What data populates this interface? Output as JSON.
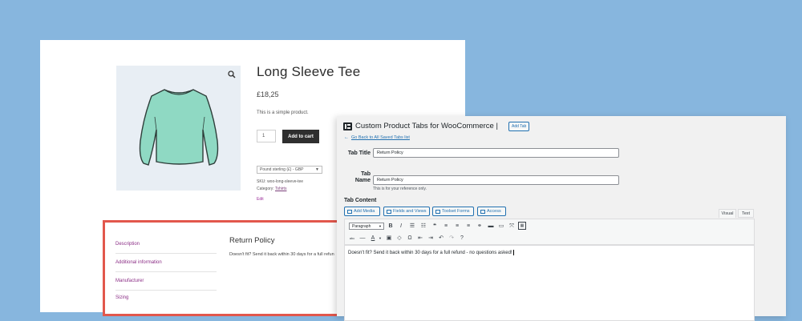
{
  "product": {
    "title": "Long Sleeve Tee",
    "price": "£18,25",
    "description": "This is a simple product.",
    "quantity": "1",
    "add_to_cart": "Add to cart",
    "currency": "Pound sterling (£) - GBP",
    "sku_label": "SKU:",
    "sku": "woo-long-sleeve-tee",
    "category_label": "Category:",
    "category": "Tshirts",
    "edit": "Edit",
    "shirt_color": "#8fd9c3"
  },
  "tabs": {
    "items": [
      "Description",
      "Additional information",
      "Manufacturer",
      "Sizing"
    ],
    "active_heading": "Return Policy",
    "active_text": "Doesn't fit? Send it back within 30 days for a full refun"
  },
  "admin": {
    "title": "Custom Product Tabs for WooCommerce |",
    "add_tab": "Add Tab",
    "back_link": "Go Back to All Saved Tabs list",
    "tab_title_label": "Tab Title",
    "tab_title_value": "Return Policy",
    "tab_name_label_1": "Tab",
    "tab_name_label_2": "Name",
    "tab_name_value": "Return Policy",
    "tab_name_help": "This is for your reference only.",
    "tab_content_label": "Tab Content",
    "media_buttons": [
      "Add Media",
      "Fields and Views",
      "Toolset Forms",
      "Access"
    ],
    "editor_tabs": [
      "Visual",
      "Text"
    ],
    "format": "Paragraph",
    "content": "Doesn't fit? Send it back within 30 days for a full refund - no questions asked!"
  }
}
